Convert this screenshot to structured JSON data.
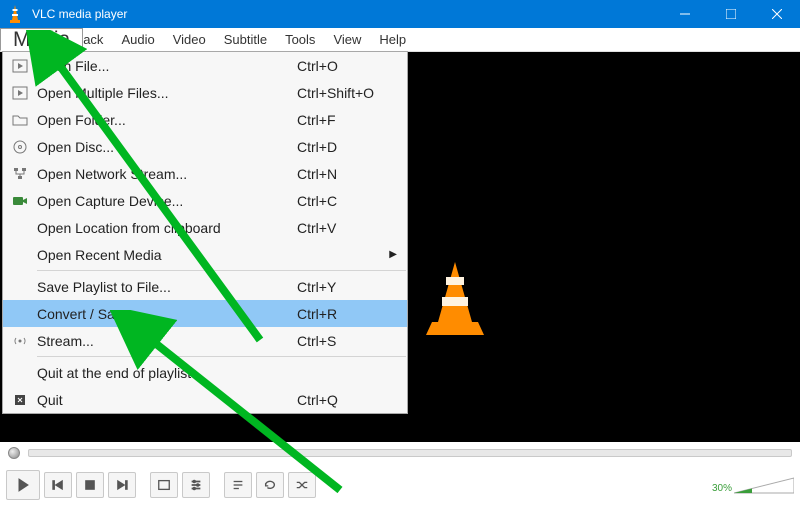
{
  "title": "VLC media player",
  "menubar": {
    "media": "Media",
    "hidden_playback_suffix": "ack",
    "audio": "Audio",
    "video": "Video",
    "subtitle": "Subtitle",
    "tools": "Tools",
    "view": "View",
    "help": "Help"
  },
  "dropdown": {
    "open_file": "Open File...",
    "open_file_sc": "Ctrl+O",
    "open_multiple": "Open Multiple Files...",
    "open_multiple_sc": "Ctrl+Shift+O",
    "open_folder": "Open Folder...",
    "open_folder_sc": "Ctrl+F",
    "open_disc": "Open Disc...",
    "open_disc_sc": "Ctrl+D",
    "open_network": "Open Network Stream...",
    "open_network_sc": "Ctrl+N",
    "open_capture": "Open Capture Device...",
    "open_capture_sc": "Ctrl+C",
    "open_clipboard": "Open Location from clipboard",
    "open_clipboard_sc": "Ctrl+V",
    "open_recent": "Open Recent Media",
    "save_playlist": "Save Playlist to File...",
    "save_playlist_sc": "Ctrl+Y",
    "convert": "Convert / Save...",
    "convert_sc": "Ctrl+R",
    "stream": "Stream...",
    "stream_sc": "Ctrl+S",
    "quit_end": "Quit at the end of playlist",
    "quit": "Quit",
    "quit_sc": "Ctrl+Q"
  },
  "volume_pct": "30%"
}
